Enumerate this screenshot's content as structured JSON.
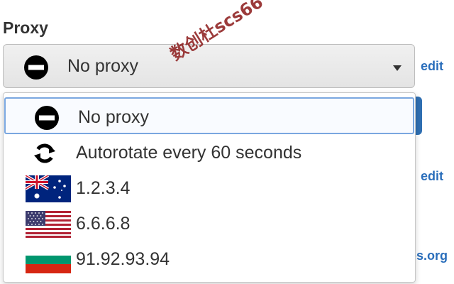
{
  "proxy_section": {
    "label": "Proxy",
    "selected_value": "No proxy",
    "selected_icon": "no-entry-icon",
    "edit_label": "edit"
  },
  "background": {
    "edit_label_2": "edit",
    "domain_fragment": "es.org",
    "accent_color": "#2f6fb2",
    "link_color": "#2a6ebb"
  },
  "dropdown": {
    "options": [
      {
        "label": "No proxy",
        "icon": "no-entry-icon",
        "selected": true
      },
      {
        "label": "Autorotate every 60 seconds",
        "icon": "refresh-icon",
        "selected": false
      },
      {
        "label": "1.2.3.4",
        "icon": "australia-flag-icon",
        "selected": false
      },
      {
        "label": "6.6.6.8",
        "icon": "usa-flag-icon",
        "selected": false
      },
      {
        "label": "91.92.93.94",
        "icon": "bulgaria-flag-icon",
        "selected": false
      }
    ]
  },
  "watermark": "数创杜scs66"
}
